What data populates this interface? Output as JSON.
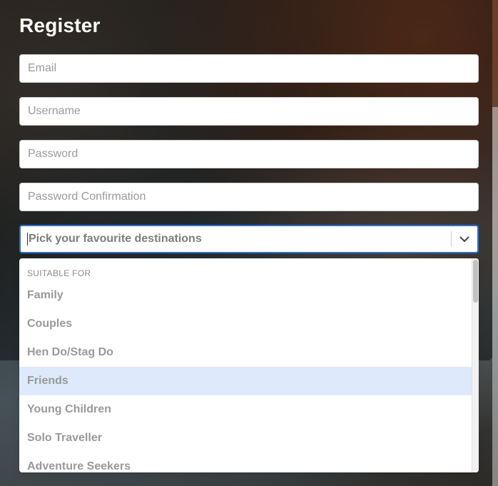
{
  "form": {
    "title": "Register",
    "email_placeholder": "Email",
    "username_placeholder": "Username",
    "password_placeholder": "Password",
    "password_confirmation_placeholder": "Password Confirmation"
  },
  "destinations_select": {
    "placeholder": "Pick your favourite destinations",
    "icon": "chevron-down-icon",
    "accent_color": "#2f6ecf",
    "menu": {
      "group_heading": "SUITABLE FOR",
      "options": [
        "Family",
        "Couples",
        "Hen Do/Stag Do",
        "Friends",
        "Young Children",
        "Solo Traveller",
        "Adventure Seekers"
      ],
      "focused_option": "Friends",
      "focused_color": "#dee9fb"
    }
  }
}
